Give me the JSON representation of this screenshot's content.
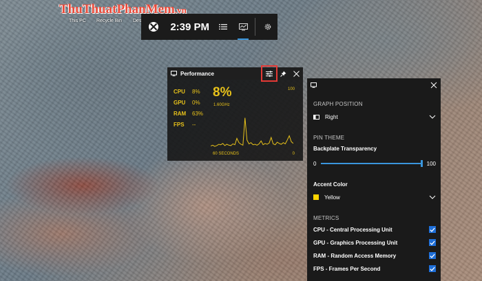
{
  "watermark": {
    "part1": "ThuThuat",
    "part2": "PhanMem",
    "part3": ".vn"
  },
  "desktop": {
    "icons": [
      "This PC",
      "Recycle Bin",
      "Des"
    ]
  },
  "gamebar": {
    "time": "2:39 PM",
    "icons": [
      "xbox-icon",
      "list-icon",
      "performance-icon",
      "gear-icon"
    ]
  },
  "performance": {
    "title": "Performance",
    "metrics": [
      {
        "name": "CPU",
        "value": "8%"
      },
      {
        "name": "GPU",
        "value": "0%"
      },
      {
        "name": "RAM",
        "value": "63%"
      },
      {
        "name": "FPS",
        "value": "--"
      }
    ],
    "current_value": "8%",
    "frequency": "1.60GHz",
    "axis_max": "100",
    "axis_time": "60 SECONDS",
    "axis_min": "0",
    "graph_values": [
      4,
      6,
      3,
      5,
      8,
      7,
      10,
      5,
      8,
      6,
      5,
      9,
      7,
      22,
      12,
      8,
      6,
      70,
      18,
      9,
      12,
      7,
      8,
      6,
      9,
      16,
      7,
      10,
      8,
      11,
      24,
      9,
      7,
      13,
      10,
      8,
      12,
      9,
      18,
      28,
      14,
      10
    ],
    "accent_color": "#e8c21a"
  },
  "settings": {
    "graph_position": {
      "title": "GRAPH POSITION",
      "value": "Right"
    },
    "pin_theme": {
      "title": "PIN THEME",
      "backplate_label": "Backplate Transparency",
      "min": "0",
      "max": "100",
      "value_fraction": 1.0
    },
    "accent": {
      "label": "Accent Color",
      "value": "Yellow",
      "color": "#ffd400"
    },
    "metrics": {
      "title": "METRICS",
      "items": [
        {
          "label": "CPU - Central Processing Unit",
          "checked": true
        },
        {
          "label": "GPU - Graphics Processing Unit",
          "checked": true
        },
        {
          "label": "RAM - Random Access Memory",
          "checked": true
        },
        {
          "label": "FPS - Frames Per Second",
          "checked": true
        }
      ]
    }
  }
}
